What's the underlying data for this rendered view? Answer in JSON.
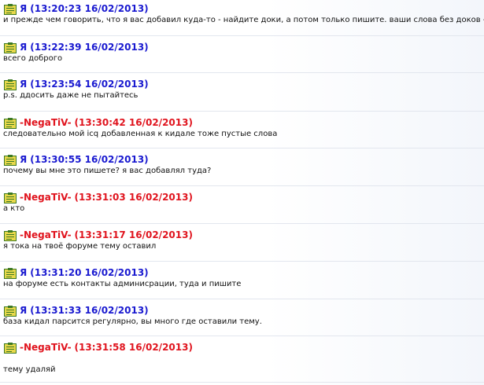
{
  "colors": {
    "self_nick": "#1a1ad0",
    "other_nick": "#e0141e",
    "message_text": "#101010",
    "divider": "#e2e6ee",
    "icon_fill": "#e7d84a",
    "icon_border": "#3d7a24"
  },
  "messages": [
    {
      "author": "self",
      "nick": "Я",
      "timestamp": "(13:20:23 16/02/2013)",
      "icon": "contact-card-icon",
      "text": "и прежде чем говорить, что я вас добавил куда-то - найдите доки, а потом только пишите. ваши слова без доков - пус"
    },
    {
      "author": "self",
      "nick": "Я",
      "timestamp": "(13:22:39 16/02/2013)",
      "icon": "contact-card-icon",
      "text": "всего доброго"
    },
    {
      "author": "self",
      "nick": "Я",
      "timestamp": "(13:23:54 16/02/2013)",
      "icon": "contact-card-icon",
      "text": "p.s. ддосить даже не пытайтесь"
    },
    {
      "author": "other",
      "nick": "-NegaTiV-",
      "timestamp": "(13:30:42 16/02/2013)",
      "icon": "contact-card-icon",
      "text": "следовательно мой icq добавленная к кидале тоже пустые слова"
    },
    {
      "author": "self",
      "nick": "Я",
      "timestamp": "(13:30:55 16/02/2013)",
      "icon": "contact-card-icon",
      "text": "почему вы мне это пишете? я вас добавлял туда?"
    },
    {
      "author": "other",
      "nick": "-NegaTiV-",
      "timestamp": "(13:31:03 16/02/2013)",
      "icon": "contact-card-icon",
      "text": "а кто"
    },
    {
      "author": "other",
      "nick": "-NegaTiV-",
      "timestamp": "(13:31:17 16/02/2013)",
      "icon": "contact-card-icon",
      "text": "я тока на твоё форуме тему оставил"
    },
    {
      "author": "self",
      "nick": "Я",
      "timestamp": "(13:31:20 16/02/2013)",
      "icon": "contact-card-icon",
      "text": "на форуме есть контакты админисрации, туда и пишите"
    },
    {
      "author": "self",
      "nick": "Я",
      "timestamp": "(13:31:33 16/02/2013)",
      "icon": "contact-card-icon",
      "text": "база кидал парсится регулярно, вы много где оставили тему."
    },
    {
      "author": "other",
      "nick": "-NegaTiV-",
      "timestamp": "(13:31:58 16/02/2013)",
      "icon": "contact-card-icon",
      "text": "тему удаляй"
    }
  ]
}
